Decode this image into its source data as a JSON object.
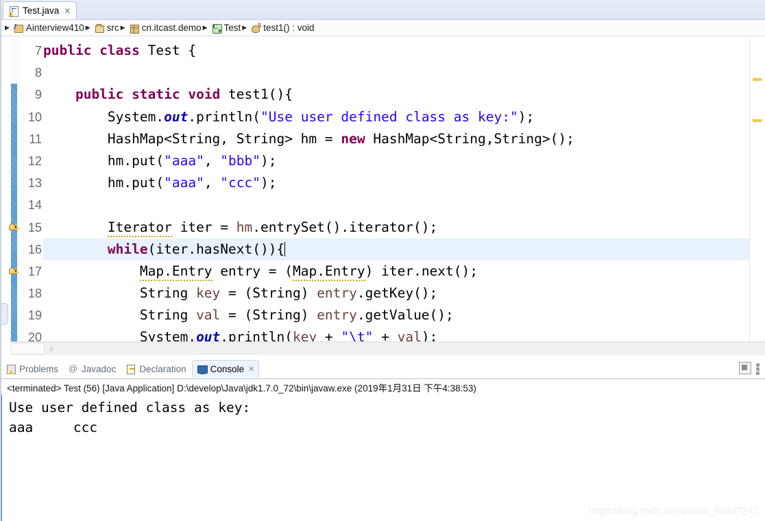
{
  "editor_tab": {
    "label": "Test.java",
    "close_glyph": "✕",
    "icon": "java-file-warning-icon"
  },
  "breadcrumb": {
    "lead_arrow": "▶",
    "separator": "▶",
    "items": [
      {
        "label": "Ainterview410",
        "icon": "java-project-icon"
      },
      {
        "label": "src",
        "icon": "source-folder-icon"
      },
      {
        "label": "cn.itcast.demo",
        "icon": "package-icon"
      },
      {
        "label": "Test",
        "icon": "class-icon"
      },
      {
        "label": "test1() : void",
        "icon": "static-method-icon"
      }
    ]
  },
  "editor": {
    "first_line_number": 7,
    "highlighted_line": 16,
    "warning_lines": [
      15,
      17
    ],
    "change_bar_from_line": 9,
    "change_bar_to_line": 20,
    "scroll_left_arrow": "‹",
    "lines": [
      {
        "n": 7,
        "tokens": [
          {
            "t": "public ",
            "c": "kw"
          },
          {
            "t": "class ",
            "c": "kw"
          },
          {
            "t": "Test {",
            "c": "typ"
          }
        ]
      },
      {
        "n": 8,
        "tokens": [
          {
            "t": "",
            "c": "typ"
          }
        ]
      },
      {
        "n": 9,
        "tokens": [
          {
            "t": "    ",
            "c": "typ"
          },
          {
            "t": "public ",
            "c": "kw"
          },
          {
            "t": "static ",
            "c": "kw"
          },
          {
            "t": "void ",
            "c": "kw"
          },
          {
            "t": "test1(){",
            "c": "typ"
          }
        ]
      },
      {
        "n": 10,
        "tokens": [
          {
            "t": "        System.",
            "c": "typ"
          },
          {
            "t": "out",
            "c": "sfield"
          },
          {
            "t": ".println(",
            "c": "typ"
          },
          {
            "t": "\"Use user defined class as key:\"",
            "c": "str"
          },
          {
            "t": ");",
            "c": "typ"
          }
        ]
      },
      {
        "n": 11,
        "tokens": [
          {
            "t": "        HashMap<String, String> hm = ",
            "c": "typ"
          },
          {
            "t": "new ",
            "c": "kw"
          },
          {
            "t": "HashMap<String,String>();",
            "c": "typ"
          }
        ]
      },
      {
        "n": 12,
        "tokens": [
          {
            "t": "        hm.put(",
            "c": "typ"
          },
          {
            "t": "\"aaa\"",
            "c": "str"
          },
          {
            "t": ", ",
            "c": "typ"
          },
          {
            "t": "\"bbb\"",
            "c": "str"
          },
          {
            "t": ");",
            "c": "typ"
          }
        ]
      },
      {
        "n": 13,
        "tokens": [
          {
            "t": "        hm.put(",
            "c": "typ"
          },
          {
            "t": "\"aaa\"",
            "c": "str"
          },
          {
            "t": ", ",
            "c": "typ"
          },
          {
            "t": "\"ccc\"",
            "c": "str"
          },
          {
            "t": ");",
            "c": "typ"
          }
        ]
      },
      {
        "n": 14,
        "tokens": [
          {
            "t": "",
            "c": "typ"
          }
        ]
      },
      {
        "n": 15,
        "tokens": [
          {
            "t": "        ",
            "c": "typ"
          },
          {
            "t": "Iterator",
            "c": "typ-warn"
          },
          {
            "t": " iter = ",
            "c": "typ"
          },
          {
            "t": "hm",
            "c": "loc"
          },
          {
            "t": ".entrySet().iterator();",
            "c": "typ"
          }
        ]
      },
      {
        "n": 16,
        "tokens": [
          {
            "t": "        ",
            "c": "typ"
          },
          {
            "t": "while",
            "c": "kw"
          },
          {
            "t": "(iter.hasNext()){",
            "c": "typ"
          }
        ],
        "caret": true
      },
      {
        "n": 17,
        "tokens": [
          {
            "t": "            ",
            "c": "typ"
          },
          {
            "t": "Map.Entry",
            "c": "typ-warn"
          },
          {
            "t": " entry = (",
            "c": "typ"
          },
          {
            "t": "Map.Entry",
            "c": "typ-warn"
          },
          {
            "t": ") iter.next();",
            "c": "typ"
          }
        ]
      },
      {
        "n": 18,
        "tokens": [
          {
            "t": "            String ",
            "c": "typ"
          },
          {
            "t": "key",
            "c": "loc"
          },
          {
            "t": " = (String) ",
            "c": "typ"
          },
          {
            "t": "entry",
            "c": "loc"
          },
          {
            "t": ".getKey();",
            "c": "typ"
          }
        ]
      },
      {
        "n": 19,
        "tokens": [
          {
            "t": "            String ",
            "c": "typ"
          },
          {
            "t": "val",
            "c": "loc"
          },
          {
            "t": " = (String) ",
            "c": "typ"
          },
          {
            "t": "entry",
            "c": "loc"
          },
          {
            "t": ".getValue();",
            "c": "typ"
          }
        ]
      },
      {
        "n": 20,
        "tokens": [
          {
            "t": "            System.",
            "c": "typ"
          },
          {
            "t": "out",
            "c": "sfield"
          },
          {
            "t": ".println(",
            "c": "typ"
          },
          {
            "t": "key",
            "c": "loc"
          },
          {
            "t": " + ",
            "c": "typ"
          },
          {
            "t": "\"\\t\"",
            "c": "str"
          },
          {
            "t": " + ",
            "c": "typ"
          },
          {
            "t": "val",
            "c": "loc"
          },
          {
            "t": ");",
            "c": "typ"
          }
        ]
      }
    ]
  },
  "bottom_panel": {
    "tabs": [
      {
        "label": "Problems",
        "icon": "problems-icon",
        "active": false
      },
      {
        "label": "Javadoc",
        "icon": "javadoc-icon",
        "active": false
      },
      {
        "label": "Declaration",
        "icon": "declaration-icon",
        "active": false
      },
      {
        "label": "Console",
        "icon": "console-icon",
        "active": true
      }
    ],
    "active_tab_close_glyph": "✕",
    "toolbar": {
      "stop_button": "stop-icon",
      "more_button": "more-icon"
    },
    "console_header": "<terminated> Test (56) [Java Application] D:\\develop\\Java\\jdk1.7.0_72\\bin\\javaw.exe (2019年1月31日 下午4:38:53)",
    "console_output": [
      "Use user defined class as key:",
      "aaa     ccc"
    ]
  },
  "watermark": "https://blog.csdn.net/weixin_40807247",
  "colors": {
    "keyword": "#7F0055",
    "string": "#2A00FF",
    "static_field": "#0000C0",
    "local_var": "#6A3E3E",
    "selection_line": "#E8F2FC",
    "change_bar": "#5A9FD4",
    "warning": "#F6C445"
  }
}
